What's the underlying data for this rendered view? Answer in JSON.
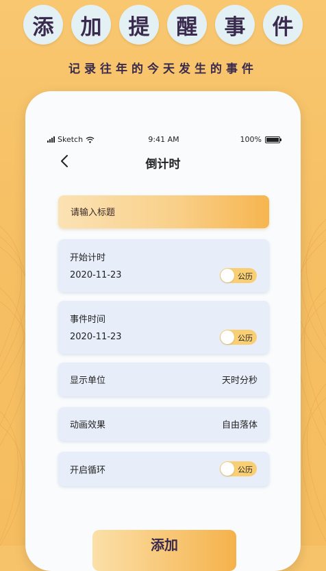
{
  "banner": {
    "title_chars": [
      "添",
      "加",
      "提",
      "醒",
      "事",
      "件"
    ],
    "subtitle": "记录往年的今天发生的事件"
  },
  "status_bar": {
    "carrier": "Sketch",
    "time": "9:41 AM",
    "battery": "100%"
  },
  "nav": {
    "title": "倒计时"
  },
  "form": {
    "title_placeholder": "请输入标题",
    "start": {
      "label": "开始计时",
      "date": "2020-11-23",
      "calendar": "公历"
    },
    "event": {
      "label": "事件时间",
      "date": "2020-11-23",
      "calendar": "公历"
    },
    "unit": {
      "label": "显示单位",
      "value": "天时分秒"
    },
    "animation": {
      "label": "动画效果",
      "value": "自由落体"
    },
    "loop": {
      "label": "开启循环",
      "calendar": "公历"
    },
    "submit_label": "添加"
  },
  "colors": {
    "accent": "#f6bf63",
    "card_bg": "#e8eef9",
    "title_text": "#3a2a4d"
  }
}
